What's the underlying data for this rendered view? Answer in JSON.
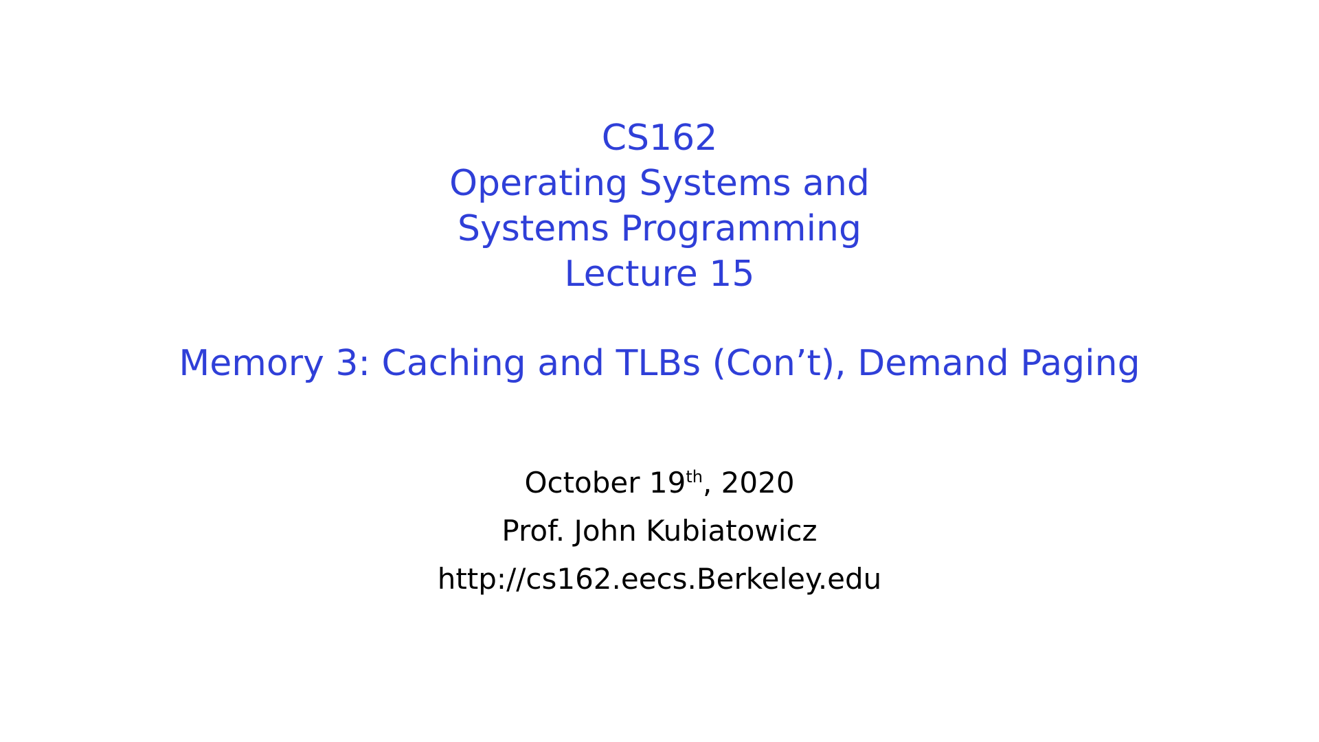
{
  "title": {
    "course": "CS162",
    "line1": "Operating Systems and",
    "line2": "Systems Programming",
    "lecture": "Lecture 15"
  },
  "subtitle": "Memory 3: Caching and TLBs (Con’t), Demand Paging",
  "info": {
    "date_main": "October 19",
    "date_suffix": "th",
    "date_year": ", 2020",
    "professor": "Prof. John Kubiatowicz",
    "url": "http://cs162.eecs.Berkeley.edu"
  },
  "colors": {
    "title": "#2f3fd8",
    "body": "#000000",
    "background": "#ffffff"
  }
}
